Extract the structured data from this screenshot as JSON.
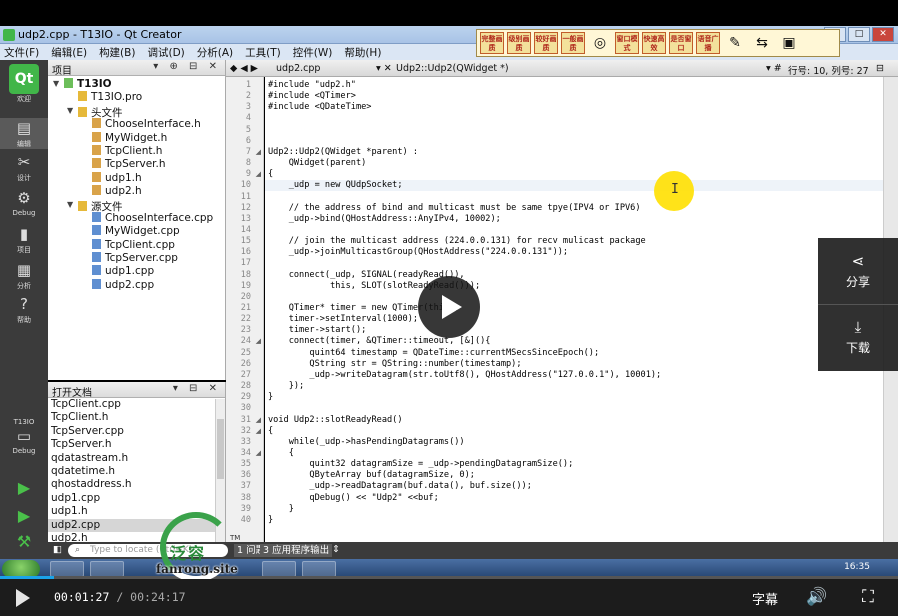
{
  "window": {
    "title": "udp2.cpp - T13IO - Qt Creator"
  },
  "menu": [
    "文件(F)",
    "编辑(E)",
    "构建(B)",
    "调试(D)",
    "分析(A)",
    "工具(T)",
    "控件(W)",
    "帮助(H)"
  ],
  "float_toolbar": [
    "完整画质",
    "级别画质",
    "较好画质",
    "一般画质",
    "窗口模式",
    "快速高效",
    "是否窗口",
    "语音广播"
  ],
  "modes": [
    "欢迎",
    "编辑",
    "设计",
    "Debug",
    "项目",
    "分析",
    "帮助"
  ],
  "kit": {
    "project": "T13IO",
    "mode": "Debug"
  },
  "project_panel": {
    "title": "项目",
    "tree": [
      {
        "label": "T13IO",
        "level": 0,
        "type": "p",
        "expanded": true
      },
      {
        "label": "T13IO.pro",
        "level": 1,
        "type": "f"
      },
      {
        "label": "头文件",
        "level": 1,
        "type": "f",
        "expanded": true
      },
      {
        "label": "ChooseInterface.h",
        "level": 2,
        "type": "h"
      },
      {
        "label": "MyWidget.h",
        "level": 2,
        "type": "h"
      },
      {
        "label": "TcpClient.h",
        "level": 2,
        "type": "h"
      },
      {
        "label": "TcpServer.h",
        "level": 2,
        "type": "h"
      },
      {
        "label": "udp1.h",
        "level": 2,
        "type": "h"
      },
      {
        "label": "udp2.h",
        "level": 2,
        "type": "h"
      },
      {
        "label": "源文件",
        "level": 1,
        "type": "f",
        "expanded": true
      },
      {
        "label": "ChooseInterface.cpp",
        "level": 2,
        "type": "c"
      },
      {
        "label": "MyWidget.cpp",
        "level": 2,
        "type": "c"
      },
      {
        "label": "TcpClient.cpp",
        "level": 2,
        "type": "c"
      },
      {
        "label": "TcpServer.cpp",
        "level": 2,
        "type": "c"
      },
      {
        "label": "udp1.cpp",
        "level": 2,
        "type": "c"
      },
      {
        "label": "udp2.cpp",
        "level": 2,
        "type": "c"
      }
    ]
  },
  "open_docs": {
    "title": "打开文档",
    "items": [
      "TcpClient.cpp",
      "TcpClient.h",
      "TcpServer.cpp",
      "TcpServer.h",
      "qdatastream.h",
      "qdatetime.h",
      "qhostaddress.h",
      "udp1.cpp",
      "udp1.h",
      "udp2.cpp",
      "udp2.h"
    ],
    "selected": 9
  },
  "editor": {
    "file": "udp2.cpp",
    "symbol": "Udp2::Udp2(QWidget *)",
    "position": "行号: 10, 列号: 27",
    "current_line": 10
  },
  "code_lines": [
    "#include \"udp2.h\"",
    "#include <QTimer>",
    "#include <QDateTime>",
    "",
    "",
    "",
    "Udp2::Udp2(QWidget *parent) :",
    "    QWidget(parent)",
    "{",
    "    _udp = new QUdpSocket;",
    "",
    "    // the address of bind and multicast must be same tpye(IPV4 or IPV6)",
    "    _udp->bind(QHostAddress::AnyIPv4, 10002);",
    "",
    "    // join the multicast address (224.0.0.131) for recv mulicast package",
    "    _udp->joinMulticastGroup(QHostAddress(\"224.0.0.131\"));",
    "",
    "    connect(_udp, SIGNAL(readyRead()),",
    "            this, SLOT(slotReadyRead()));",
    "",
    "    QTimer* timer = new QTimer(this);",
    "    timer->setInterval(1000);",
    "    timer->start();",
    "    connect(timer, &QTimer::timeout, [&](){",
    "        quint64 timestamp = QDateTime::currentMSecsSinceEpoch();",
    "        QString str = QString::number(timestamp);",
    "        _udp->writeDatagram(str.toUtf8(), QHostAddress(\"127.0.0.1\"), 10001);",
    "    });",
    "}",
    "",
    "void Udp2::slotReadyRead()",
    "{",
    "    while(_udp->hasPendingDatagrams())",
    "    {",
    "        quint32 datagramSize = _udp->pendingDatagramSize();",
    "        QByteArray buf(datagramSize, 0);",
    "        _udp->readDatagram(buf.data(), buf.size());",
    "        qDebug() << \"Udp2\" <<buf;",
    "    }",
    "}"
  ],
  "output_bar": {
    "locate_placeholder": "Type to locate (Ctrl+K)",
    "tabs": [
      "1 问题",
      "3 应用程序输出"
    ]
  },
  "taskbar": {
    "clock": "16:35"
  },
  "watermark": {
    "cn": "泛容",
    "en": "fanrong.site",
    "tm": "TM"
  },
  "player": {
    "current": "00:01:27",
    "total": "/ 00:24:17",
    "progress": 0.06,
    "subtitle_label": "字幕",
    "share_label": "分享",
    "download_label": "下载"
  }
}
